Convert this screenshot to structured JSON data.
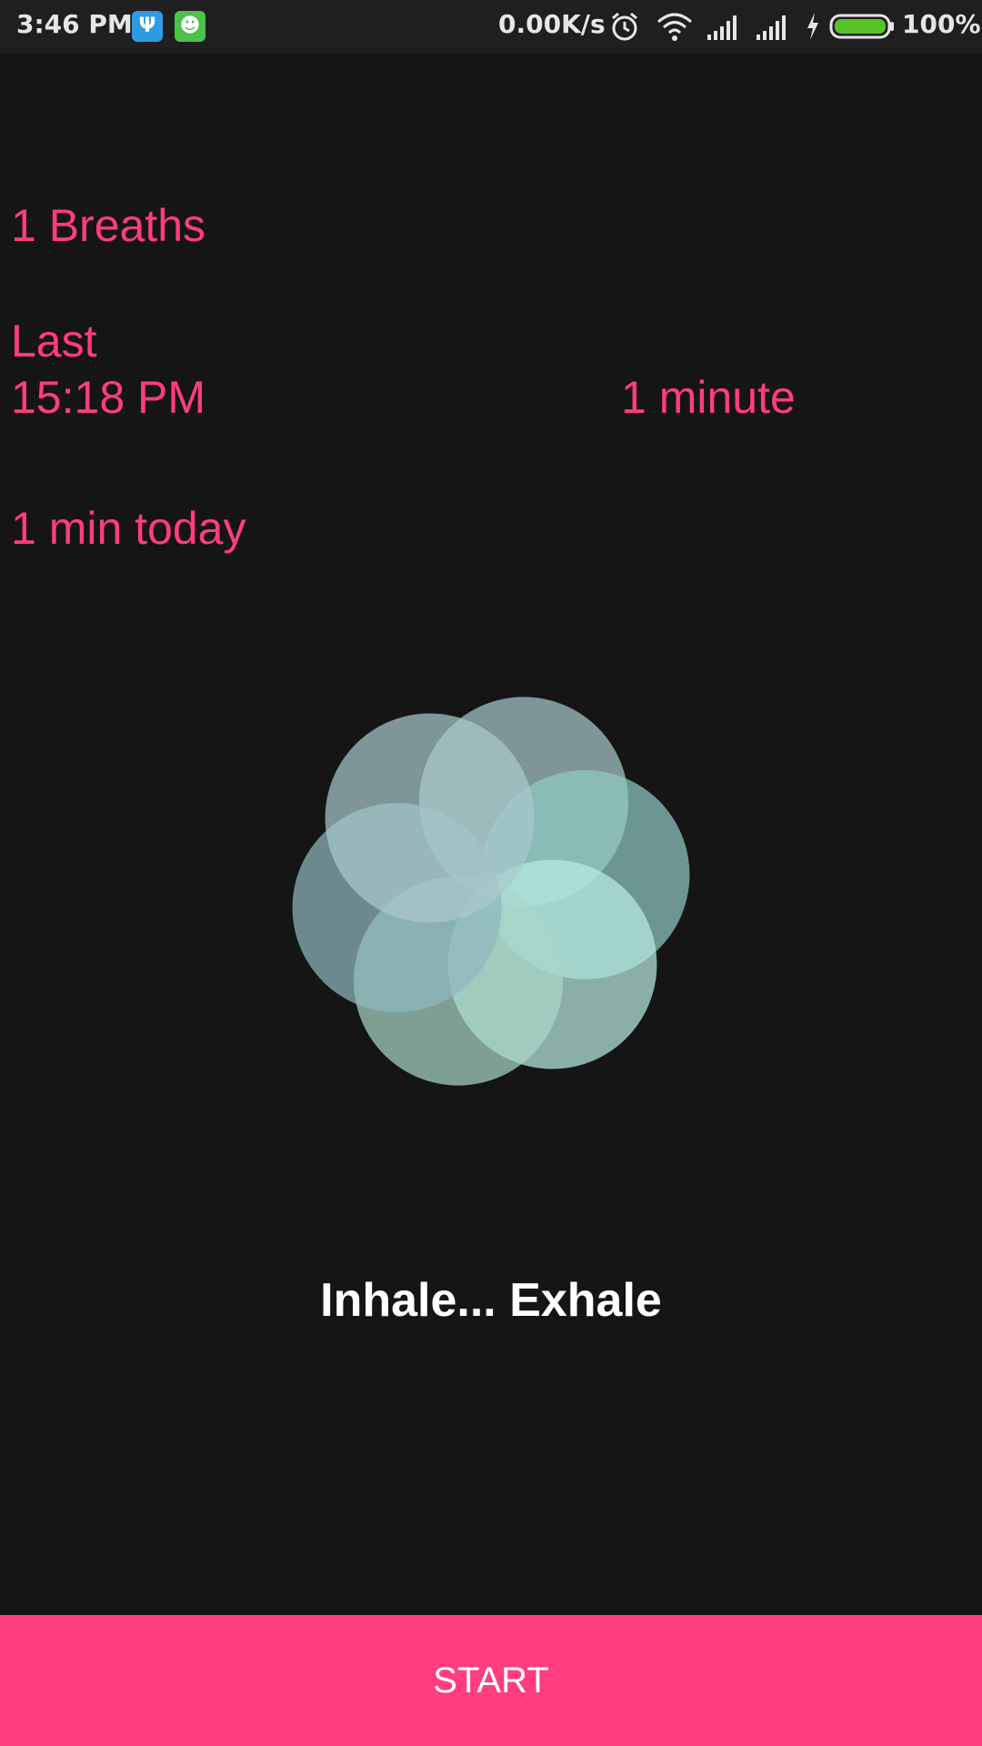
{
  "status_bar": {
    "time": "3:46 PM",
    "net_speed": "0.00K/s",
    "battery_percent": "100%",
    "icons": [
      "usb-icon",
      "android-icon",
      "alarm-icon",
      "wifi-icon",
      "signal-icon",
      "signal-icon",
      "charging-icon",
      "battery-icon"
    ]
  },
  "stats": {
    "breaths": "1 Breaths",
    "last_label": "Last",
    "last_time": "15:18 PM",
    "last_duration": "1 minute",
    "today": "1 min today"
  },
  "breathing": {
    "prompt": "Inhale... Exhale",
    "petal_colors": [
      "#a9c9cc",
      "#8fc9c4",
      "#b7ece2",
      "#a9d6c8",
      "#8fb8bc"
    ]
  },
  "actions": {
    "start_label": "START"
  },
  "colors": {
    "accent": "#ff3d7f",
    "background": "#151515"
  }
}
